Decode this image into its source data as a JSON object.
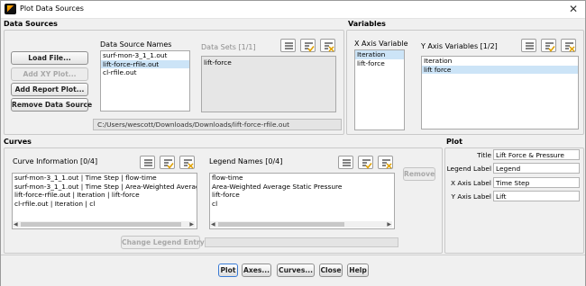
{
  "window": {
    "title": "Plot Data Sources"
  },
  "data_sources": {
    "title": "Data Sources",
    "load_file": "Load File...",
    "add_xy_plot": "Add XY Plot...",
    "add_report_plot": "Add Report Plot...",
    "remove_data_source": "Remove Data Source",
    "names_label": "Data Source Names",
    "names": [
      "surf-mon-3_1_1.out",
      "lift-force-rfile.out",
      "cl-rfile.out"
    ],
    "selected_index": 1,
    "data_sets_label": "Data Sets  [1/1]",
    "data_sets": [
      "lift-force"
    ],
    "path": "C:/Users/wescott/Downloads/Downloads/lift-force-rfile.out"
  },
  "variables": {
    "title": "Variables",
    "x_label": "X Axis Variable",
    "x_items": [
      "Iteration",
      "lift-force"
    ],
    "y_label": "Y Axis Variables  [1/2]",
    "y_items": [
      "Iteration",
      "lift force"
    ]
  },
  "curves": {
    "title": "Curves",
    "info_label": "Curve Information  [0/4]",
    "info_items": [
      "surf-mon-3_1_1.out | Time Step | flow-time",
      "surf-mon-3_1_1.out | Time Step | Area-Weighted Average",
      "lift-force-rfile.out | Iteration | lift-force",
      "cl-rfile.out | Iteration | cl"
    ],
    "legend_label": "Legend Names  [0/4]",
    "legend_items": [
      "flow-time",
      "Area-Weighted Average Static Pressure",
      "lift-force",
      "cl"
    ],
    "remove": "Remove",
    "change_legend": "Change Legend Entry",
    "legend_entry_value": ""
  },
  "plot": {
    "title": "Plot",
    "title_label": "Title",
    "title_value": "Lift Force & Pressure",
    "legend_label": "Legend Label",
    "legend_value": "Legend",
    "x_label": "X Axis Label",
    "x_value": "Time Step",
    "y_label": "Y Axis Label",
    "y_value": "Lift"
  },
  "footer": {
    "plot": "Plot",
    "axes": "Axes...",
    "curves": "Curves...",
    "close": "Close",
    "help": "Help"
  }
}
